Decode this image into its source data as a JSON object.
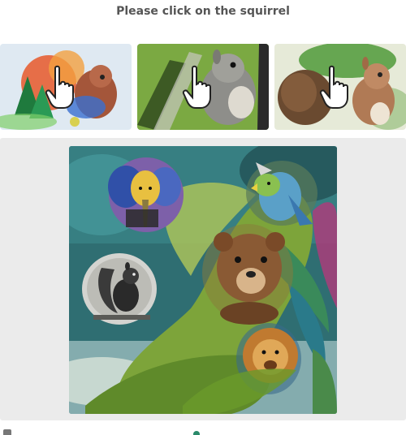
{
  "instruction": "Please click on the squirrel",
  "examples": [
    {
      "subject": "squirrel",
      "style": "colorful-watercolor",
      "cursor": "hand-pointer-icon"
    },
    {
      "subject": "squirrel",
      "style": "green-gray-painting",
      "cursor": "hand-pointer-icon"
    },
    {
      "subject": "squirrel",
      "style": "brown-sepia-painting",
      "cursor": "hand-pointer-icon"
    }
  ],
  "puzzle": {
    "background": "jungle-watercolor",
    "animals": [
      "elephant",
      "parrot",
      "bear",
      "squirrel",
      "lion"
    ]
  },
  "colors": {
    "instruction_text": "#555555",
    "stage_background": "#ebebeb"
  }
}
